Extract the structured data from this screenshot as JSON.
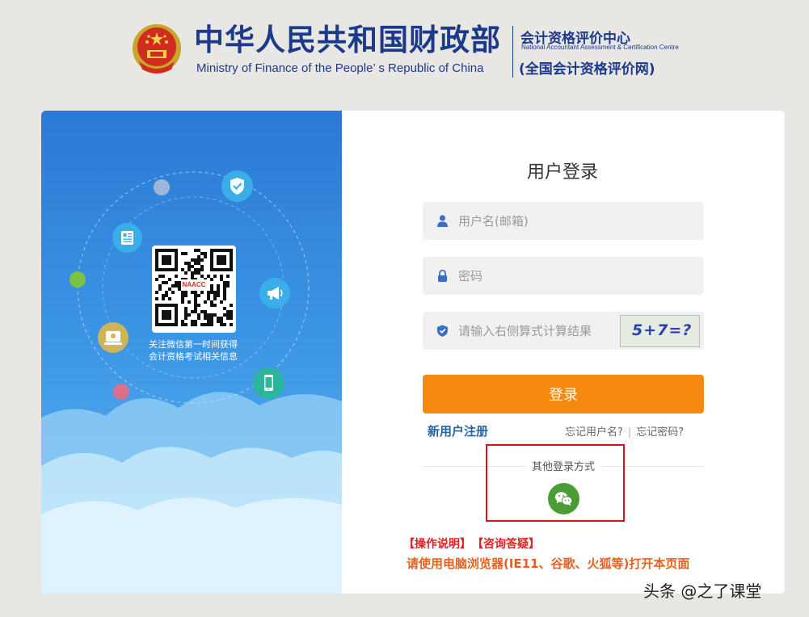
{
  "header": {
    "ministry_cn": "中华人民共和国财政部",
    "ministry_en": "Ministry of Finance of the People’ s Republic of China",
    "center_cn": "会计资格评价中心",
    "center_en": "National Accountant Assessment & Certification Centre",
    "center_net": "(全国会计资格评价网)"
  },
  "left_panel": {
    "qr_logo_text": "NAACC",
    "qr_caption_line1": "关注微信第一时间获得",
    "qr_caption_line2": "会计资格考试相关信息",
    "icons": [
      "shield-check-icon",
      "news-icon",
      "megaphone-icon",
      "badge-icon",
      "phone-icon"
    ]
  },
  "login": {
    "title": "用户登录",
    "username_placeholder": "用户名(邮箱)",
    "password_placeholder": "密码",
    "captcha_placeholder": "请输入右侧算式计算结果",
    "captcha_text": "5+7=?",
    "submit_label": "登录",
    "register_label": "新用户注册",
    "forgot_username": "忘记用户名?",
    "forgot_separator": "|",
    "forgot_password": "忘记密码?",
    "other_login_label": "其他登录方式",
    "wechat_icon": "wechat-icon"
  },
  "footer": {
    "operation_guide": "【操作说明】",
    "faq": "【咨询答疑】",
    "browser_notice": "请使用电脑浏览器(IE11、谷歌、火狐等)打开本页面"
  },
  "watermark": "头条 @之了课堂",
  "colors": {
    "brand_blue": "#1b3a8c",
    "login_button": "#f5890f",
    "link_blue": "#2266aa",
    "highlight_red": "#e01010",
    "notice_orange": "#e8601c",
    "wechat_green": "#4a9d36"
  }
}
